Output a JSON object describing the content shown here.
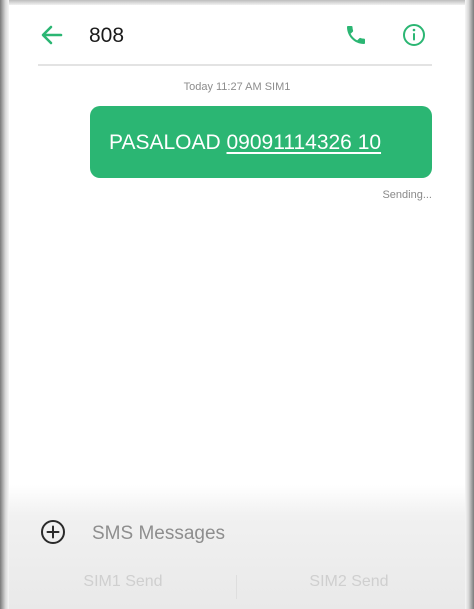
{
  "header": {
    "title": "808",
    "back_icon": "arrow-left-icon",
    "call_icon": "phone-icon",
    "info_icon": "info-circle-icon"
  },
  "thread": {
    "timestamp": "Today 11:27 AM  SIM1",
    "message": {
      "keyword": "PASALOAD ",
      "number": "09091114326 10",
      "status": "Sending..."
    }
  },
  "composer": {
    "add_icon": "plus-circle-icon",
    "placeholder": "SMS Messages",
    "sim1_label": "SIM1 Send",
    "sim2_label": "SIM2 Send"
  },
  "colors": {
    "accent": "#2bb673",
    "bubble": "#2bb673",
    "text": "#1b1b1b",
    "muted": "#8d8d8d"
  }
}
